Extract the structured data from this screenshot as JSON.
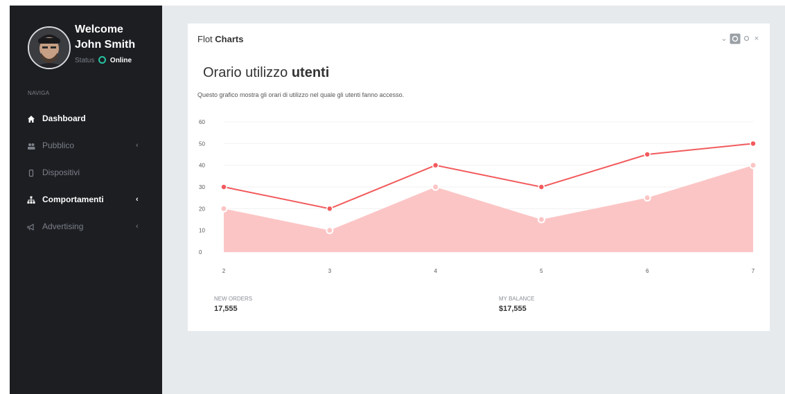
{
  "sidebar": {
    "welcome": "Welcome",
    "username": "John Smith",
    "status_label": "Status",
    "status_value": "Online",
    "nav_heading": "NAVIGA",
    "items": [
      {
        "label": "Dashboard",
        "active": true,
        "has_chevron": false
      },
      {
        "label": "Pubblico",
        "active": false,
        "has_chevron": true
      },
      {
        "label": "Dispositivi",
        "active": false,
        "has_chevron": false
      },
      {
        "label": "Comportamenti",
        "active": true,
        "has_chevron": true
      },
      {
        "label": "Advertising",
        "active": false,
        "has_chevron": true
      }
    ],
    "chevron": "‹"
  },
  "panel": {
    "title_normal": "Flot ",
    "title_bold": "Charts",
    "tools": {
      "collapse": "⌄",
      "close": "×"
    },
    "chart_title_normal": "Orario utilizzo ",
    "chart_title_bold": "utenti",
    "chart_description": "Questo grafico mostra gli orari di utilizzo nel quale gli utenti fanno accesso.",
    "stats": [
      {
        "label": "NEW ORDERS",
        "value": "17,555"
      },
      {
        "label": "MY BALANCE",
        "value": "$17,555"
      }
    ]
  },
  "colors": {
    "sidebar_bg": "#1c1e22",
    "accent_red": "#f25a5c",
    "area_fill": "#fcc5c5",
    "online": "#27c3a3"
  },
  "chart_data": {
    "type": "line",
    "x": [
      2,
      3,
      4,
      5,
      6,
      7
    ],
    "series": [
      {
        "values": [
          30,
          20,
          40,
          30,
          45,
          50
        ],
        "style": "line"
      },
      {
        "values": [
          20,
          10,
          30,
          15,
          25,
          40
        ],
        "style": "area"
      }
    ],
    "yticks": [
      0,
      10,
      20,
      30,
      40,
      50,
      60
    ],
    "xticks": [
      2,
      3,
      4,
      5,
      6,
      7
    ],
    "ylim": [
      0,
      60
    ],
    "xlim": [
      2,
      7
    ],
    "grid": true
  }
}
